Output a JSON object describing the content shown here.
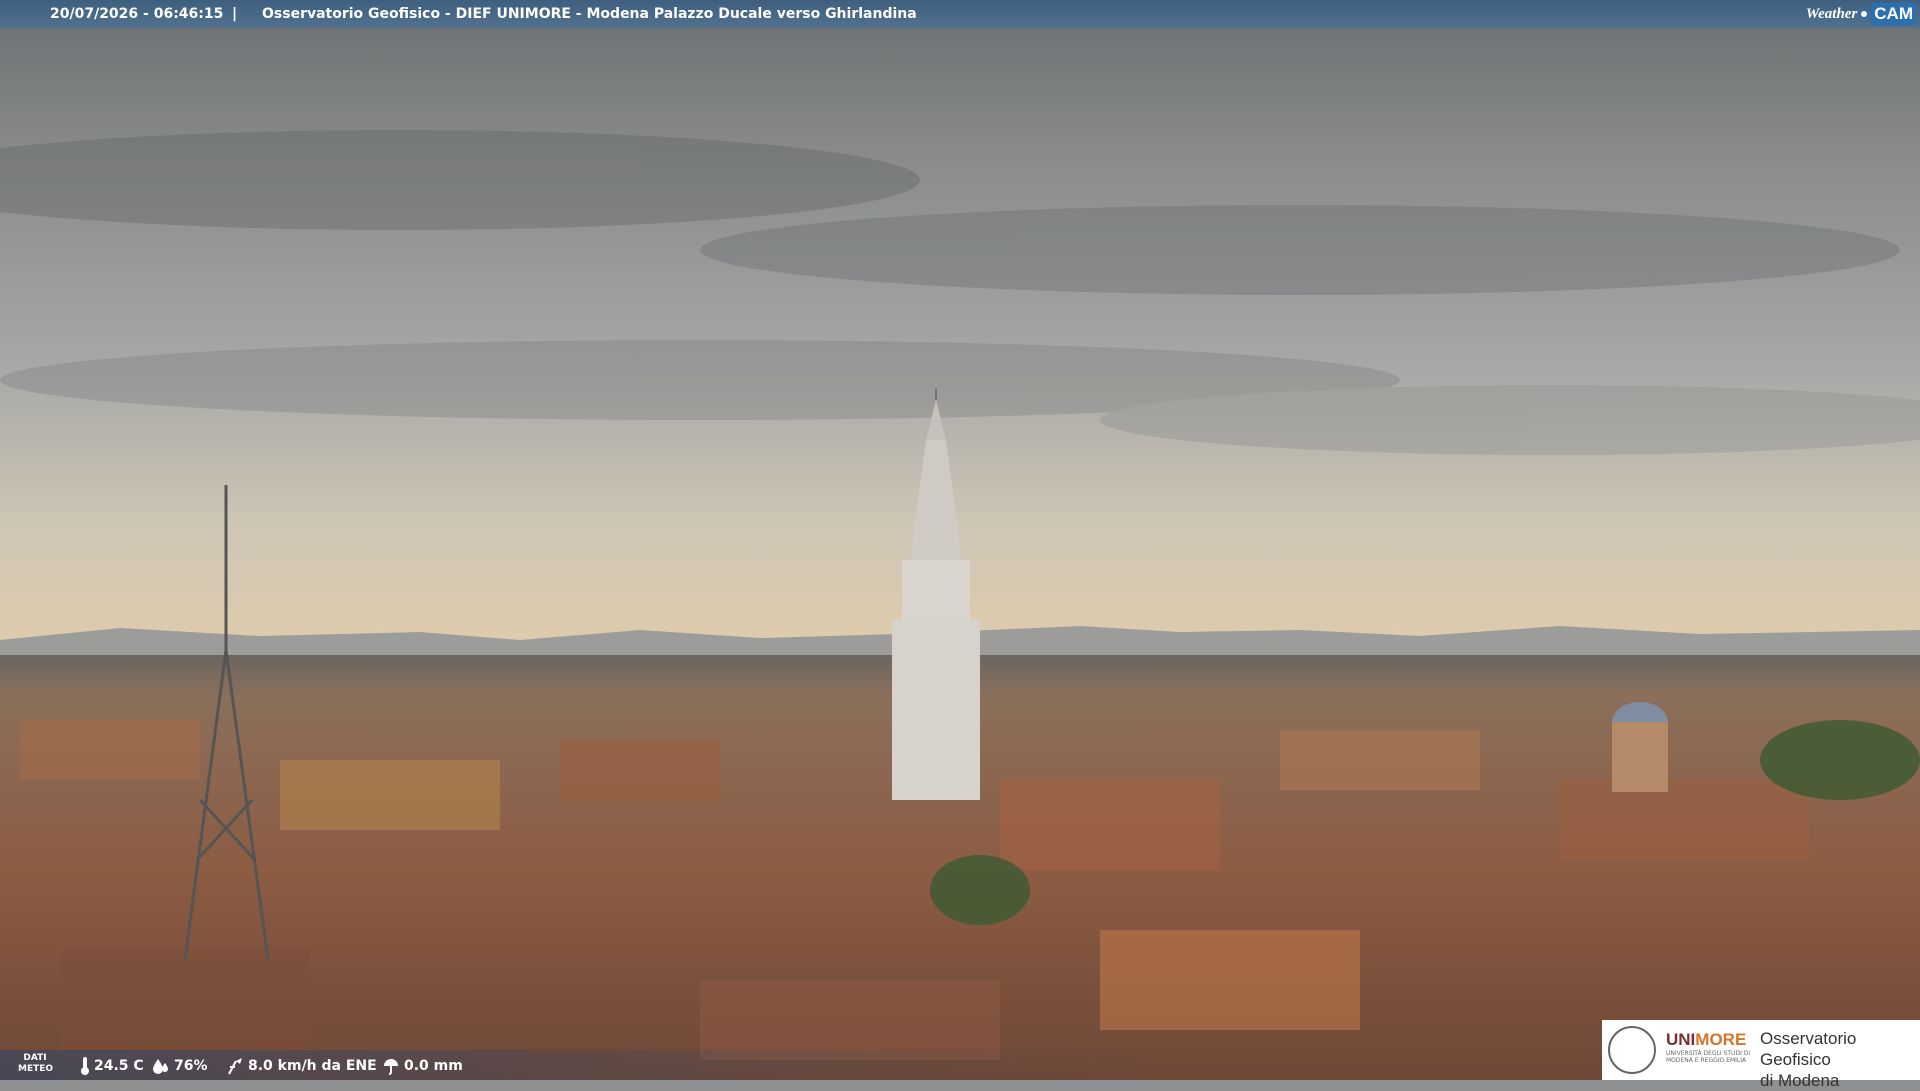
{
  "header": {
    "timestamp": "20/07/2026 - 06:46:15",
    "separator": "|",
    "title": "Osservatorio Geofisico - DIEF UNIMORE - Modena Palazzo Ducale verso Ghirlandina",
    "logo_weather": "Weather",
    "logo_cam": "CAM"
  },
  "meteo": {
    "label_line1": "DATI",
    "label_line2": "METEO",
    "temperature": "24.5 C",
    "humidity": "76%",
    "wind": "8.0 km/h da ENE",
    "rain": "0.0 mm"
  },
  "logo": {
    "uni": "UNI",
    "more": "MORE",
    "university_line": "UNIVERSITÀ DEGLI STUDI DI MODENA E REGGIO EMILIA",
    "observatory_line1": "Osservatorio Geofisico",
    "observatory_line2": "di Modena"
  },
  "colors": {
    "sky_top": "#6f7274",
    "sky_mid": "#a9aaa8",
    "horizon": "#d9c9ad",
    "roofs": "#8a5a40",
    "header_bar": "#456584",
    "brand_blue": "#2b6fb0",
    "unimore_red": "#7a2e2e",
    "unimore_orange": "#d6732c"
  }
}
